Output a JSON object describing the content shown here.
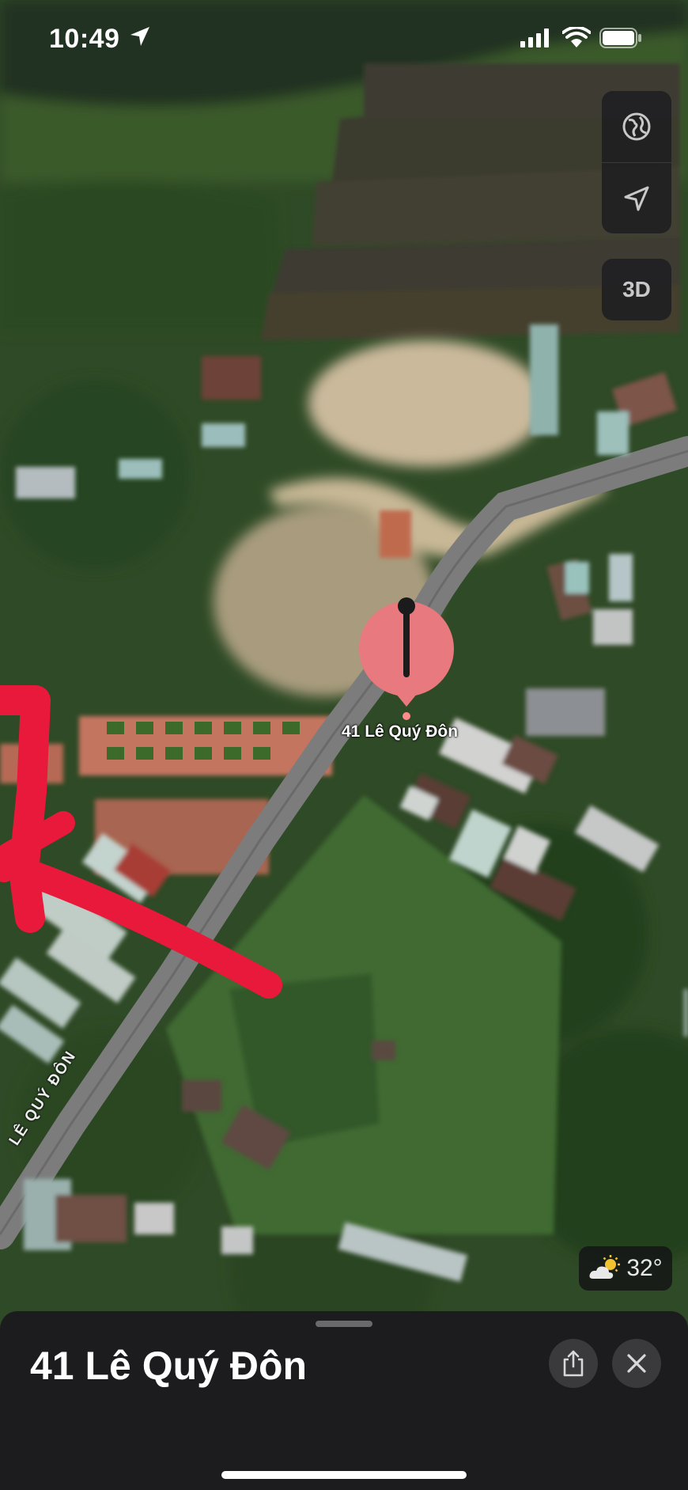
{
  "status_bar": {
    "time": "10:49",
    "icons": [
      "location-arrow-icon",
      "cellular-signal-icon",
      "wifi-icon",
      "battery-icon"
    ]
  },
  "map": {
    "view": "satellite",
    "pin": {
      "label": "41 Lê Quý Đôn",
      "icon": "pin-icon",
      "color": "#e8797e"
    },
    "street_label": "LÊ QUÝ ĐÔN",
    "annotation": {
      "shape": "hand-drawn arrow pointing left",
      "color": "#e8193a"
    }
  },
  "controls": {
    "map_mode_icon": "globe-icon",
    "locate_icon": "location-arrow-icon",
    "three_d_label": "3D"
  },
  "weather": {
    "icon": "partly-sunny-icon",
    "temperature": "32°"
  },
  "sheet": {
    "title": "41 Lê Quý Đôn",
    "share_icon": "share-icon",
    "close_icon": "close-icon"
  },
  "colors": {
    "sheet_bg": "#1c1c1e",
    "button_bg": "#3a3a3c",
    "pin": "#e8797e",
    "annotation": "#e8193a"
  }
}
